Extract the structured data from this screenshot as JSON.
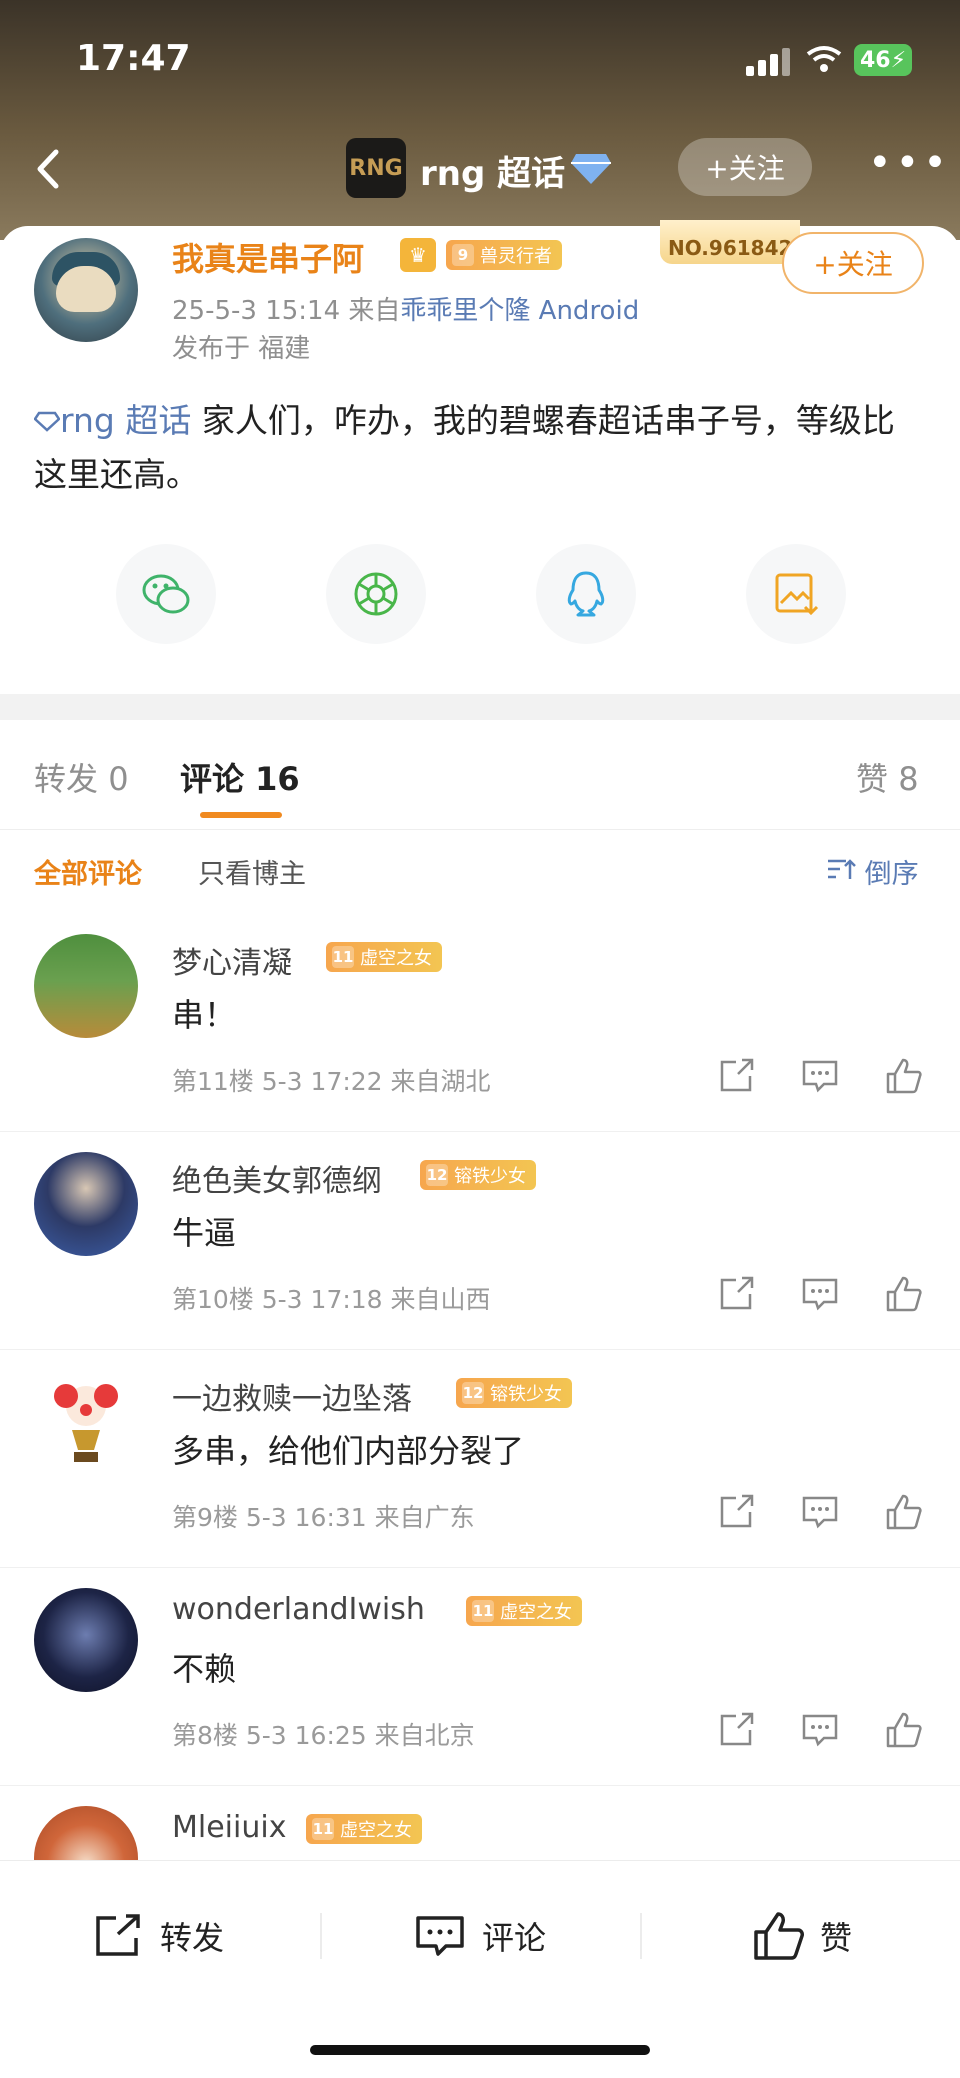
{
  "status_bar": {
    "time": "17:47",
    "battery": "46"
  },
  "nav": {
    "topic_logo": "RNG",
    "title": "rng 超话",
    "follow_label": "+关注"
  },
  "post": {
    "badge_no": "NO.961842",
    "follow_label": "+关注",
    "author": "我真是串子阿",
    "author_level": "9",
    "author_title": "兽灵行者",
    "time": "25-5-3 15:14",
    "from_label": "来自",
    "source": "乖乖里个隆 Android",
    "location": "发布于 福建",
    "topic_tag": "rng 超话",
    "text": "家人们，咋办，我的碧螺春超话串子号，等级比这里还高。"
  },
  "tabs": [
    {
      "label": "转发",
      "count": "0"
    },
    {
      "label": "评论",
      "count": "16"
    },
    {
      "label": "赞",
      "count": "8"
    }
  ],
  "filters": {
    "all": "全部评论",
    "author_only": "只看博主",
    "sort": "倒序"
  },
  "comments": [
    {
      "name": "梦心清凝",
      "level": "11",
      "title": "虚空之女",
      "text": "串！",
      "meta": "第11楼  5-3 17:22  来自湖北"
    },
    {
      "name": "绝色美女郭德纲",
      "level": "12",
      "title": "镕铁少女",
      "text": "牛逼",
      "meta": "第10楼  5-3 17:18  来自山西"
    },
    {
      "name": "一边救赎一边坠落",
      "level": "12",
      "title": "镕铁少女",
      "text": "多串，给他们内部分裂了",
      "meta": "第9楼  5-3 16:31  来自广东"
    },
    {
      "name": "wonderlandIwish",
      "level": "11",
      "title": "虚空之女",
      "text": "不赖",
      "meta": "第8楼  5-3 16:25  来自北京"
    },
    {
      "name": "Mleiiuix",
      "level": "11",
      "title": "虚空之女",
      "text": "",
      "meta": ""
    }
  ],
  "bottom_bar": {
    "repost": "转发",
    "comment": "评论",
    "like": "赞"
  },
  "colors": {
    "accent_orange": "#e98318",
    "link_blue": "#5a7bb4",
    "tag_gold": "#f3b548"
  }
}
